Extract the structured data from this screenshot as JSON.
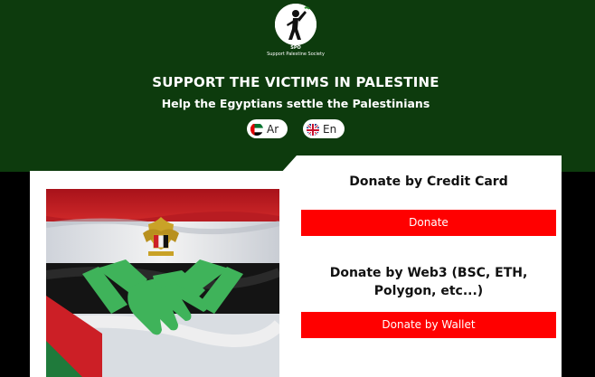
{
  "header": {
    "logo_abbr": "SPO",
    "logo_name": "Support Palestine Society",
    "title": "SUPPORT THE VICTIMS IN PALESTINE",
    "subtitle": "Help the Egyptians settle the Palestinians",
    "languages": [
      {
        "label": "Ar",
        "flag": "uae-flag-icon"
      },
      {
        "label": "En",
        "flag": "uk-flag-icon"
      }
    ]
  },
  "donate_card": {
    "credit_title": "Donate by Credit Card",
    "credit_button": "Donate",
    "web3_title": "Donate by Web3 (BSC, ETH, Polygon, etc...)",
    "web3_button": "Donate by Wallet"
  },
  "colors": {
    "header_bg": "#0d3b0d",
    "accent_red": "#ff0000",
    "handshake_green": "#3fb35a"
  }
}
